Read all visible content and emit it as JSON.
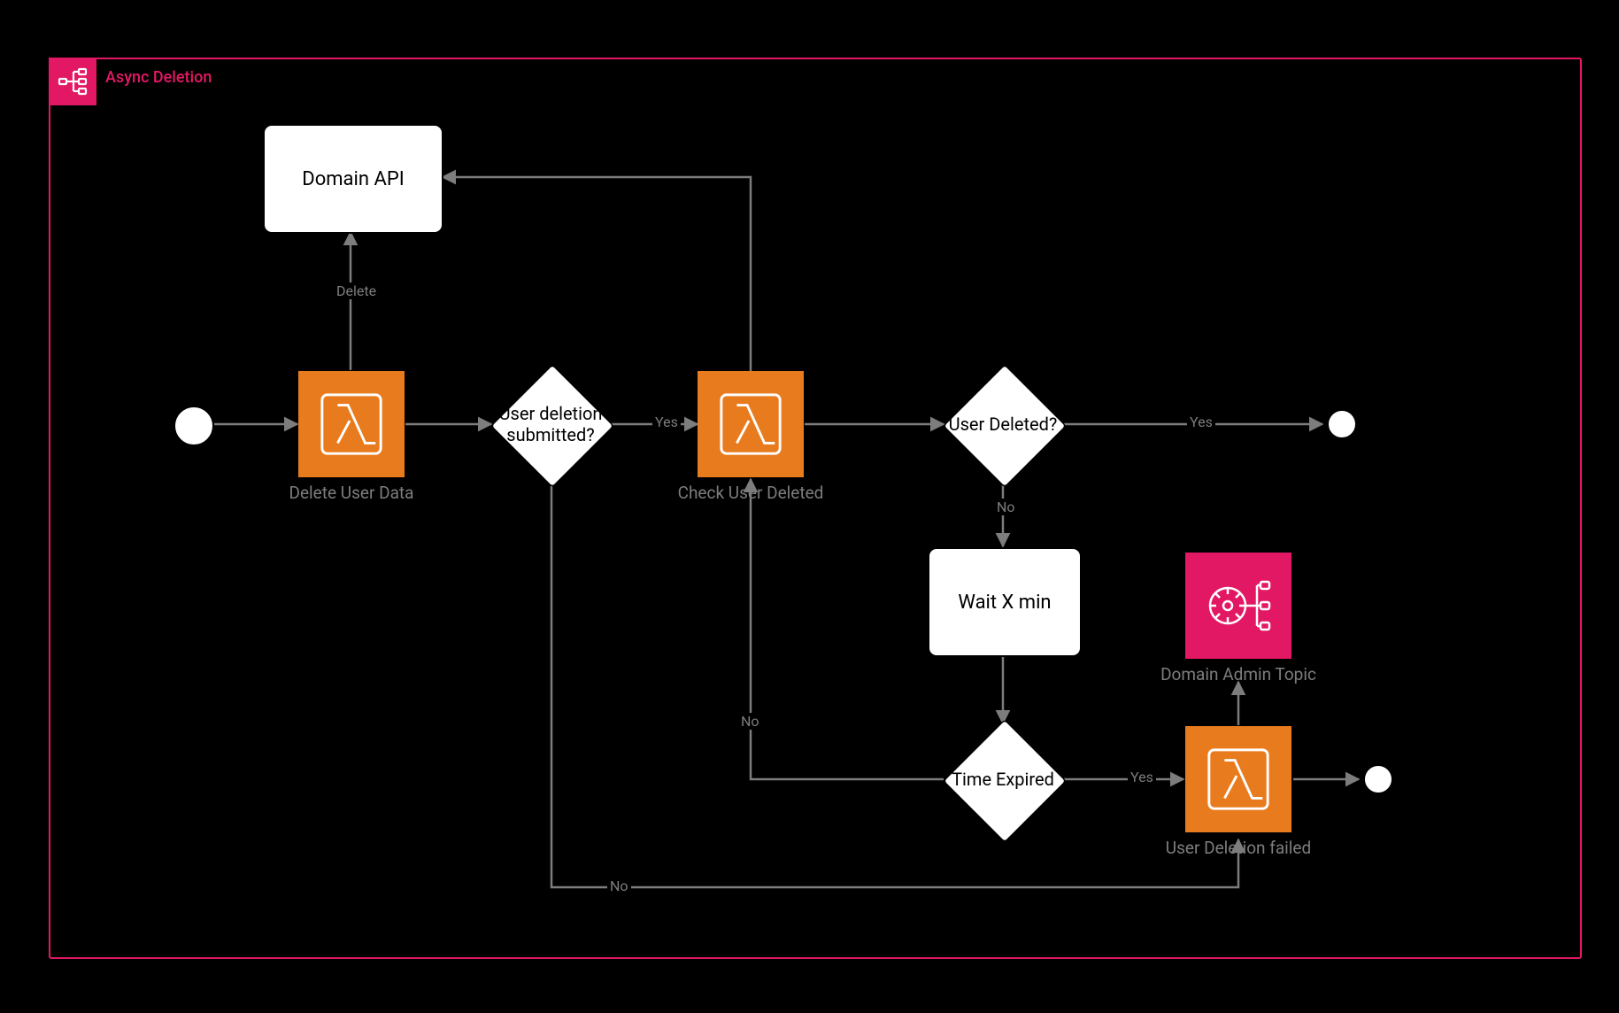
{
  "colors": {
    "accent_pink": "#e31864",
    "accent_orange": "#e87b1d",
    "edge": "#7d7d7d",
    "bg": "#000000",
    "node_fill": "#ffffff"
  },
  "pool": {
    "title": "Async Deletion",
    "icon": "step-functions-icon"
  },
  "nodes": {
    "start": {
      "id": "start-event",
      "kind": "start-event"
    },
    "delete_user": {
      "id": "lambda-delete-user",
      "kind": "lambda",
      "label": "Delete User Data"
    },
    "domain_api": {
      "id": "domain-api-box",
      "kind": "task",
      "label": "Domain API"
    },
    "gw_submitted": {
      "id": "gw-submitted",
      "kind": "exclusive-gateway",
      "label": "User deletion submitted?"
    },
    "check_user": {
      "id": "lambda-check-user",
      "kind": "lambda",
      "label": "Check User Deleted"
    },
    "gw_deleted": {
      "id": "gw-deleted",
      "kind": "exclusive-gateway",
      "label": "User Deleted?"
    },
    "wait": {
      "id": "wait-box",
      "kind": "task",
      "label": "Wait X min"
    },
    "gw_expired": {
      "id": "gw-expired",
      "kind": "exclusive-gateway",
      "label": "Time Expired"
    },
    "fail": {
      "id": "lambda-fail",
      "kind": "lambda",
      "label": "User Deletion failed"
    },
    "topic": {
      "id": "sns-topic",
      "kind": "sns",
      "label": "Domain Admin Topic"
    },
    "end1": {
      "id": "end-event-success",
      "kind": "end-event"
    },
    "end2": {
      "id": "end-event-fail",
      "kind": "end-event"
    }
  },
  "edges": {
    "e_start_delete": {
      "from": "start",
      "to": "delete_user",
      "label": ""
    },
    "e_delete_domain": {
      "from": "delete_user",
      "to": "domain_api",
      "label": "Delete"
    },
    "e_delete_gw": {
      "from": "delete_user",
      "to": "gw_submitted",
      "label": ""
    },
    "e_gw_yes_check": {
      "from": "gw_submitted",
      "to": "check_user",
      "label": "Yes"
    },
    "e_gw_no_fail": {
      "from": "gw_submitted",
      "to": "fail",
      "label": "No"
    },
    "e_check_domain": {
      "from": "check_user",
      "to": "domain_api",
      "label": ""
    },
    "e_check_gw2": {
      "from": "check_user",
      "to": "gw_deleted",
      "label": ""
    },
    "e_gw2_yes_end": {
      "from": "gw_deleted",
      "to": "end1",
      "label": "Yes"
    },
    "e_gw2_no_wait": {
      "from": "gw_deleted",
      "to": "wait",
      "label": "No"
    },
    "e_wait_gw3": {
      "from": "wait",
      "to": "gw_expired",
      "label": ""
    },
    "e_gw3_no_check": {
      "from": "gw_expired",
      "to": "check_user",
      "label": "No"
    },
    "e_gw3_yes_fail": {
      "from": "gw_expired",
      "to": "fail",
      "label": "Yes"
    },
    "e_fail_topic": {
      "from": "fail",
      "to": "topic",
      "label": ""
    },
    "e_fail_end2": {
      "from": "fail",
      "to": "end2",
      "label": ""
    }
  },
  "edge_label_text": {
    "yes": "Yes",
    "no": "No",
    "delete": "Delete"
  }
}
